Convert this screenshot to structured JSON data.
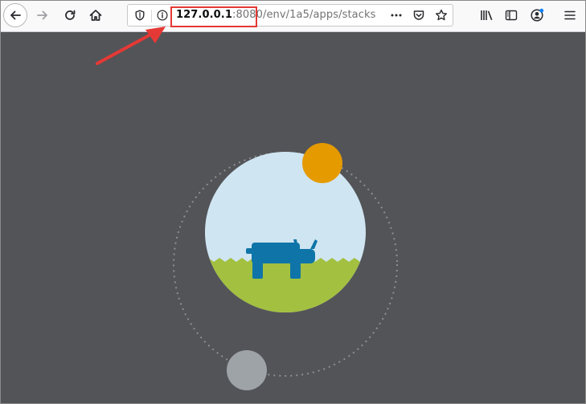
{
  "browser": {
    "url_host": "127.0.0.1",
    "url_rest": ":8080/env/1a5/apps/stacks"
  },
  "icons": {
    "back": "back-arrow-icon",
    "forward": "forward-arrow-icon",
    "reload": "reload-icon",
    "home": "home-icon",
    "tracking": "shield-icon",
    "info": "info-icon",
    "more": "more-dots-icon",
    "pocket": "pocket-icon",
    "bookmark": "star-icon",
    "library": "library-icon",
    "sidebar": "sidebar-icon",
    "account": "account-icon",
    "menu": "hamburger-menu-icon"
  },
  "colors": {
    "annotation": "#e53935",
    "page_background": "#535458",
    "sky": "#cfe5f2",
    "grass": "#a3c040",
    "logo": "#0f75a8",
    "orange_orb": "#e59a00",
    "gray_orb": "#9ea3a8",
    "notification_dot": "#0a84ff"
  }
}
